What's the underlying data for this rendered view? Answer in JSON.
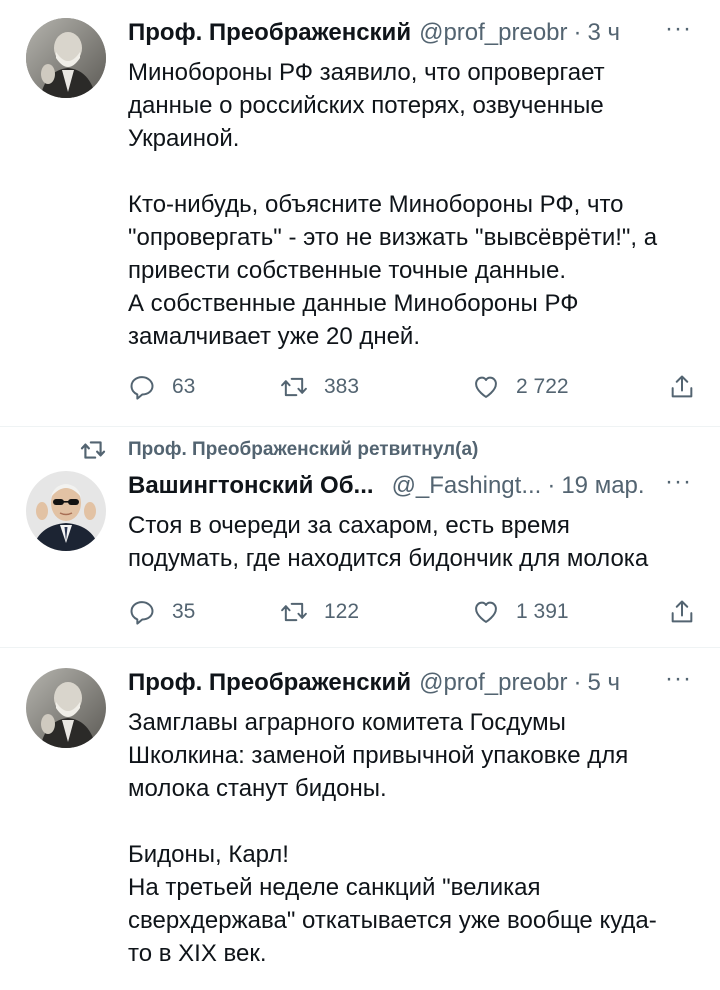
{
  "tweets": [
    {
      "author": "Проф. Преображенский",
      "handle": "@prof_preobr",
      "separator": "·",
      "time": "3 ч",
      "more": "···",
      "paragraphs": [
        [
          "Минобороны РФ заявило, что опровергает",
          "данные о российских потерях, озвученные",
          "Украиной."
        ],
        [
          "Кто-нибудь, объясните Минобороны РФ, что",
          "\"опровергать\" - это не визжать \"вывсёврёти!\", а",
          "привести собственные точные данные.",
          "А собственные данные Минобороны РФ",
          "замалчивает уже 20 дней."
        ]
      ],
      "replies": "63",
      "retweets": "383",
      "likes": "2 722"
    },
    {
      "retweet_label": "Проф. Преображенский ретвитнул(а)",
      "author": "Вашингтонский Об...",
      "handle": "@_Fashingt...",
      "separator": "·",
      "time": "19 мар.",
      "more": "···",
      "paragraphs": [
        [
          "Стоя в очереди за сахаром, есть время",
          "подумать, где находится бидончик для молока"
        ]
      ],
      "replies": "35",
      "retweets": "122",
      "likes": "1 391"
    },
    {
      "author": "Проф. Преображенский",
      "handle": "@prof_preobr",
      "separator": "·",
      "time": "5 ч",
      "more": "···",
      "paragraphs": [
        [
          "Замглавы аграрного комитета Госдумы",
          "Школкина: заменой привычной упаковке для",
          "молока станут бидоны."
        ],
        [
          "Бидоны, Карл!",
          "На третьей неделе санкций \"великая",
          "сверхдержава\" откатывается уже вообще куда-",
          "то в XIX век."
        ]
      ]
    }
  ],
  "icons": {
    "reply": "reply-icon",
    "retweet": "retweet-icon",
    "like": "heart-icon",
    "share": "share-icon",
    "more": "more-dots-icon"
  },
  "colors": {
    "text": "#0f1419",
    "secondary": "#536471",
    "divider": "#eff3f4"
  }
}
